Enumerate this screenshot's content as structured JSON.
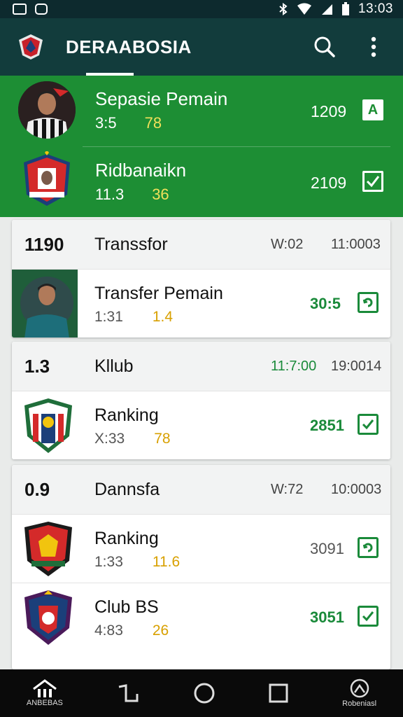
{
  "status_bar": {
    "time": "13:03"
  },
  "app_bar": {
    "title": "DERAABOSIA"
  },
  "featured": [
    {
      "name": "Sepasie Pemain",
      "sub_a": "3:5",
      "sub_b": "78",
      "value": "1209",
      "check_label": "A"
    },
    {
      "name": "Ridbanaikn",
      "sub_a": "11.3",
      "sub_b": "36",
      "value": "2109",
      "check_label": "✓"
    }
  ],
  "cards": [
    {
      "num": "1190",
      "title": "Transsfor",
      "meta1": "W:02",
      "meta2": "11:0003",
      "rows": [
        {
          "name": "Transfer Pemain",
          "sub_a": "1:31",
          "sub_b": "1.4",
          "value": "30:5"
        }
      ]
    },
    {
      "num": "1.3",
      "title": "Kllub",
      "meta1": "11:7:00",
      "meta2": "19:0014",
      "rows": [
        {
          "name": "Ranking",
          "sub_a": "X:33",
          "sub_b": "78",
          "value": "2851"
        }
      ]
    },
    {
      "num": "0.9",
      "title": "Dannsfa",
      "meta1": "W:72",
      "meta2": "10:0003",
      "rows": [
        {
          "name": "Ranking",
          "sub_a": "1:33",
          "sub_b": "11.6",
          "value": "3091"
        },
        {
          "name": "Club BS",
          "sub_a": "4:83",
          "sub_b": "26",
          "value": "3051"
        }
      ]
    }
  ],
  "nav": {
    "home_label": "ANBEBAS",
    "profile_label": "Robeniasl"
  },
  "colors": {
    "app_bar": "#123c3c",
    "featured": "#1d8e34",
    "accent": "#1a8a3a",
    "highlight": "#f1e05a"
  }
}
